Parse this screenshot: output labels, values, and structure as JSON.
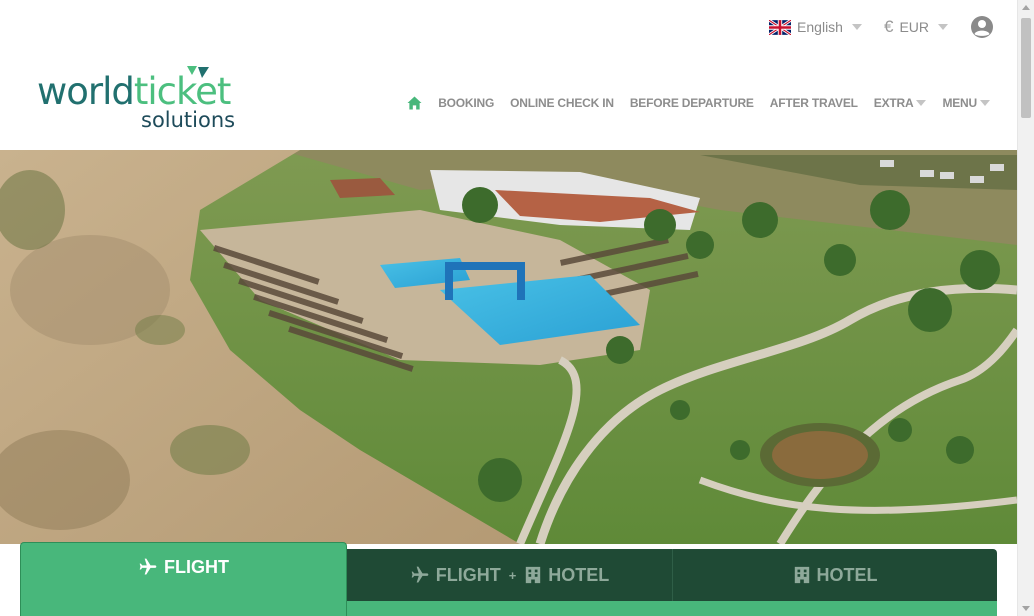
{
  "header": {
    "language": {
      "label": "English",
      "flag_icon": "uk-flag-icon"
    },
    "currency": {
      "symbol": "€",
      "label": "EUR"
    },
    "account_icon": "user-icon"
  },
  "logo": {
    "word_part1": "world",
    "word_part2": "ticket",
    "word_sub": "solutions",
    "colors": {
      "teal": "#21706f",
      "green": "#4cbf7f",
      "navy": "#1e4b5a"
    }
  },
  "nav": {
    "home_icon": "home-icon",
    "items": [
      {
        "label": "BOOKING"
      },
      {
        "label": "ONLINE CHECK IN"
      },
      {
        "label": "BEFORE DEPARTURE"
      },
      {
        "label": "AFTER TRAVEL"
      },
      {
        "label": "EXTRA",
        "has_dropdown": true
      },
      {
        "label": "MENU",
        "has_dropdown": true
      }
    ]
  },
  "hero": {
    "image_subject": "aerial view of a beach resort with pool, sunbeds, dunes and gardens"
  },
  "booking_tabs": {
    "active_color": "#48b77b",
    "inactive_color": "#1f4a35",
    "tabs": [
      {
        "label": "FLIGHT",
        "icon": "plane-icon",
        "active": true
      },
      {
        "label_a": "FLIGHT",
        "plus": "+",
        "label_b": "HOTEL",
        "icon_a": "plane-icon",
        "icon_b": "hotel-icon",
        "active": false
      },
      {
        "label": "HOTEL",
        "icon": "hotel-icon",
        "active": false
      }
    ]
  }
}
